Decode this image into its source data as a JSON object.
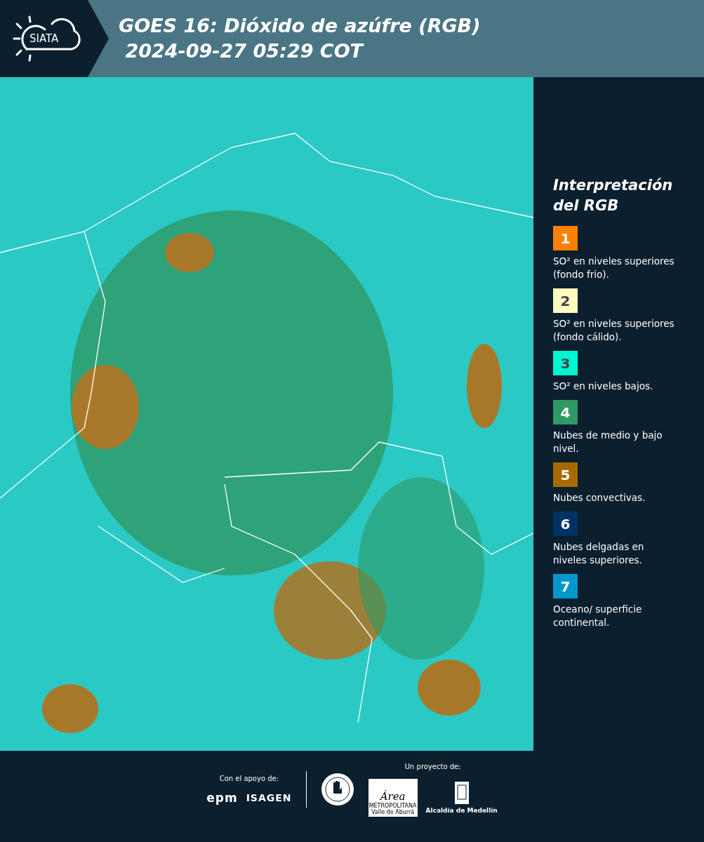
{
  "header": {
    "logo": "SIATA",
    "title": "GOES 16: Dióxido de azúfre (RGB)",
    "timestamp": "2024-09-27 05:29 COT"
  },
  "legend": {
    "title": "Interpretación del RGB",
    "items": [
      {
        "number": "1",
        "color": "#ff7f00",
        "text": "SO² en niveles superiores (fondo frio)."
      },
      {
        "number": "2",
        "color": "#fff9c0",
        "text": "SO² en niveles superiores (fondo cálido)."
      },
      {
        "number": "3",
        "color": "#00f5d0",
        "text": "SO² en niveles bajos."
      },
      {
        "number": "4",
        "color": "#2f9966",
        "text": "Nubes de medio y bajo nivel."
      },
      {
        "number": "5",
        "color": "#a86a00",
        "text": "Nubes convectivas."
      },
      {
        "number": "6",
        "color": "#003264",
        "text": "Nubes delgadas en niveles superiores."
      },
      {
        "number": "7",
        "color": "#0098cc",
        "text": "Oceano/ superficie continental."
      }
    ]
  },
  "footer": {
    "support_label": "Con el apoyo de:",
    "support_logos": [
      "epm",
      "ISAGEN"
    ],
    "project_label": "Un proyecto de:",
    "area_logo": {
      "title": "Área",
      "line_1": "METROPOLITANA",
      "line_2": "Valle de Aburrá"
    },
    "alcaldia_label": "Alcaldía de Medellín"
  }
}
